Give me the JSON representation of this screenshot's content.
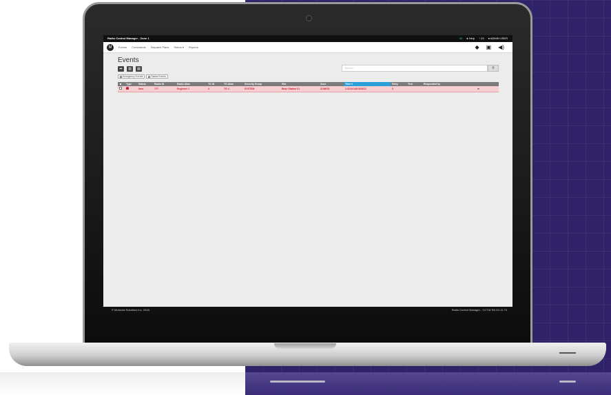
{
  "colors": {
    "brand_dark": "#101010",
    "accent_blue": "#2a9fd8",
    "alert_row": "#f6cfd2",
    "alert_text": "#c8202d",
    "background_purple": "#2f2268",
    "status_count_green": "#39b54a"
  },
  "app": {
    "title": "Radio Control Manager - Zone 1",
    "status": {
      "count": "22",
      "help": "Help",
      "user_count": "23",
      "user": "ADMIN USER"
    }
  },
  "nav": {
    "items": [
      "Events",
      "Commands",
      "Dispatch Plans",
      "Status ▾",
      "Reports"
    ],
    "icons": [
      "chat-icon",
      "clipboard-icon",
      "speaker-icon"
    ]
  },
  "page": {
    "title": "Events",
    "toolbar": [
      "forward-icon",
      "trash-icon",
      "print-icon"
    ],
    "filters": [
      "Emergency Events",
      "Status Events"
    ],
    "search_placeholder": "Search",
    "search_icon": "search-icon"
  },
  "table": {
    "columns": [
      "",
      "Type",
      "Status",
      "Radio ID",
      "Radio Alias",
      "TG ID",
      "TG Alias",
      "Security Group",
      "Site",
      "Zone",
      "Time ▾",
      "Retry",
      "Text",
      "Responded by",
      ""
    ],
    "rows": [
      {
        "type_icon": "alarm-icon",
        "status": "New",
        "radio_id": "777",
        "radio_alias": "Engineer 1",
        "tg_id": "4",
        "tg_alias": "TG 4",
        "security_group": "SYSTEM",
        "site": "Base Station 01",
        "zone": "ZONE01",
        "time": "1:32:04 AM 8/20/21",
        "retry": "0",
        "text": "",
        "responded_by": "",
        "action_icon": "forward-icon"
      }
    ]
  },
  "footer": {
    "copyright": "© Motorola Solutions Inc. 2018",
    "version": "Radio Control Manager - CCTW R8.XX.11.73"
  }
}
